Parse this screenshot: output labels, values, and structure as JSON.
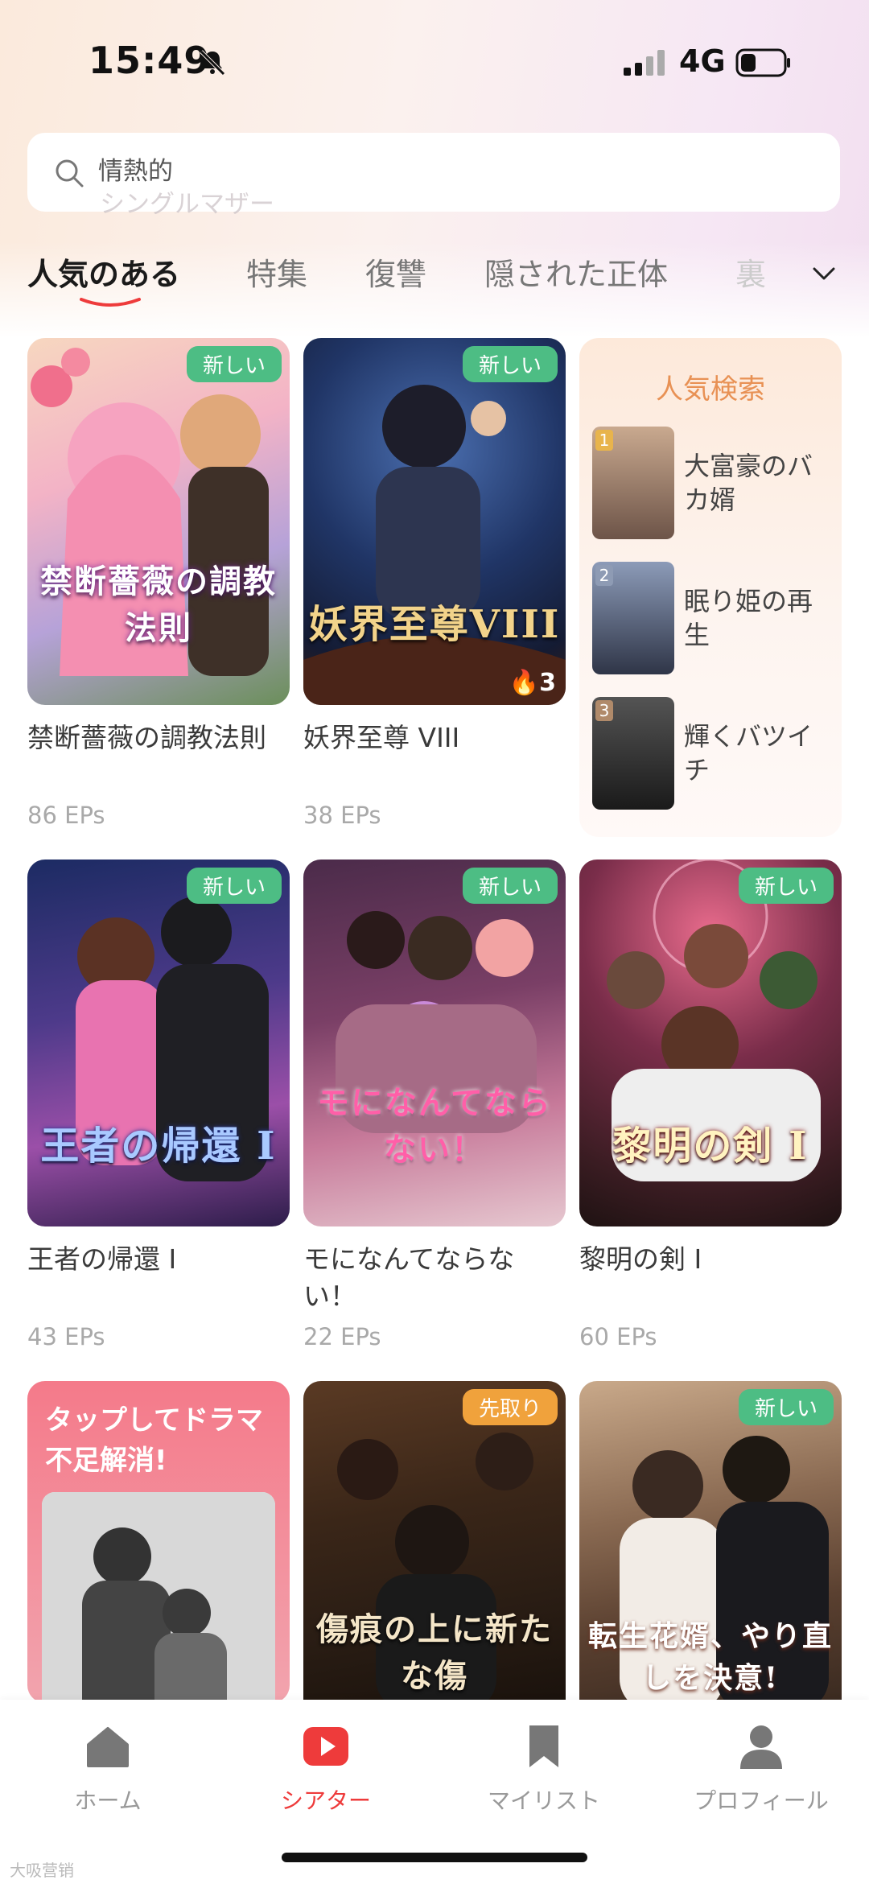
{
  "status_bar": {
    "time": "15:49",
    "network": "4G"
  },
  "search": {
    "value": "情熱的",
    "ghost": "シングルマザー"
  },
  "tabs": [
    {
      "label": "人気のある",
      "active": true
    },
    {
      "label": "特集"
    },
    {
      "label": "復讐"
    },
    {
      "label": "隠された正体"
    },
    {
      "label": "裏"
    }
  ],
  "cards": [
    {
      "title": "禁断薔薇の調教法則",
      "eps": "86 EPs",
      "badge": "新しい",
      "poster_text": "禁断薔薇の調教法則"
    },
    {
      "title": "妖界至尊 VIII",
      "eps": "38 EPs",
      "badge": "新しい",
      "poster_text": "妖界至尊VIII",
      "fire": "3"
    },
    {
      "title": "王者の帰還 I",
      "eps": "43 EPs",
      "badge": "新しい",
      "poster_text": "王者の帰還 I"
    },
    {
      "title": "モになんてならない！",
      "eps": "22 EPs",
      "badge": "新しい",
      "poster_text": "モになんてならない！"
    },
    {
      "title": "黎明の剣 I",
      "eps": "60 EPs",
      "badge": "新しい",
      "poster_text": "黎明の剣 I"
    },
    {
      "badge": "先取り",
      "poster_text": "傷痕の上に新たな傷"
    },
    {
      "badge": "新しい",
      "poster_text": "転生花婿、やり直しを決意!"
    }
  ],
  "hot_search": {
    "title": "人気検索",
    "items": [
      {
        "rank": "1",
        "label": "大富豪のバカ婿"
      },
      {
        "rank": "2",
        "label": "眠り姫の再生"
      },
      {
        "rank": "3",
        "label": "輝くバツイチ"
      }
    ]
  },
  "promo": {
    "text": "タップしてドラマ不足解消!"
  },
  "nav": [
    {
      "label": "ホーム",
      "icon": "home-icon"
    },
    {
      "label": "シアター",
      "icon": "theater-icon",
      "active": true
    },
    {
      "label": "マイリスト",
      "icon": "bookmark-icon"
    },
    {
      "label": "プロフィール",
      "icon": "profile-icon"
    }
  ],
  "colors": {
    "accent": "#ee3b3b",
    "badge_new": "#4dbd84",
    "badge_early": "#f0a23c",
    "hot_title": "#e89154"
  },
  "watermark": "大吸营销"
}
